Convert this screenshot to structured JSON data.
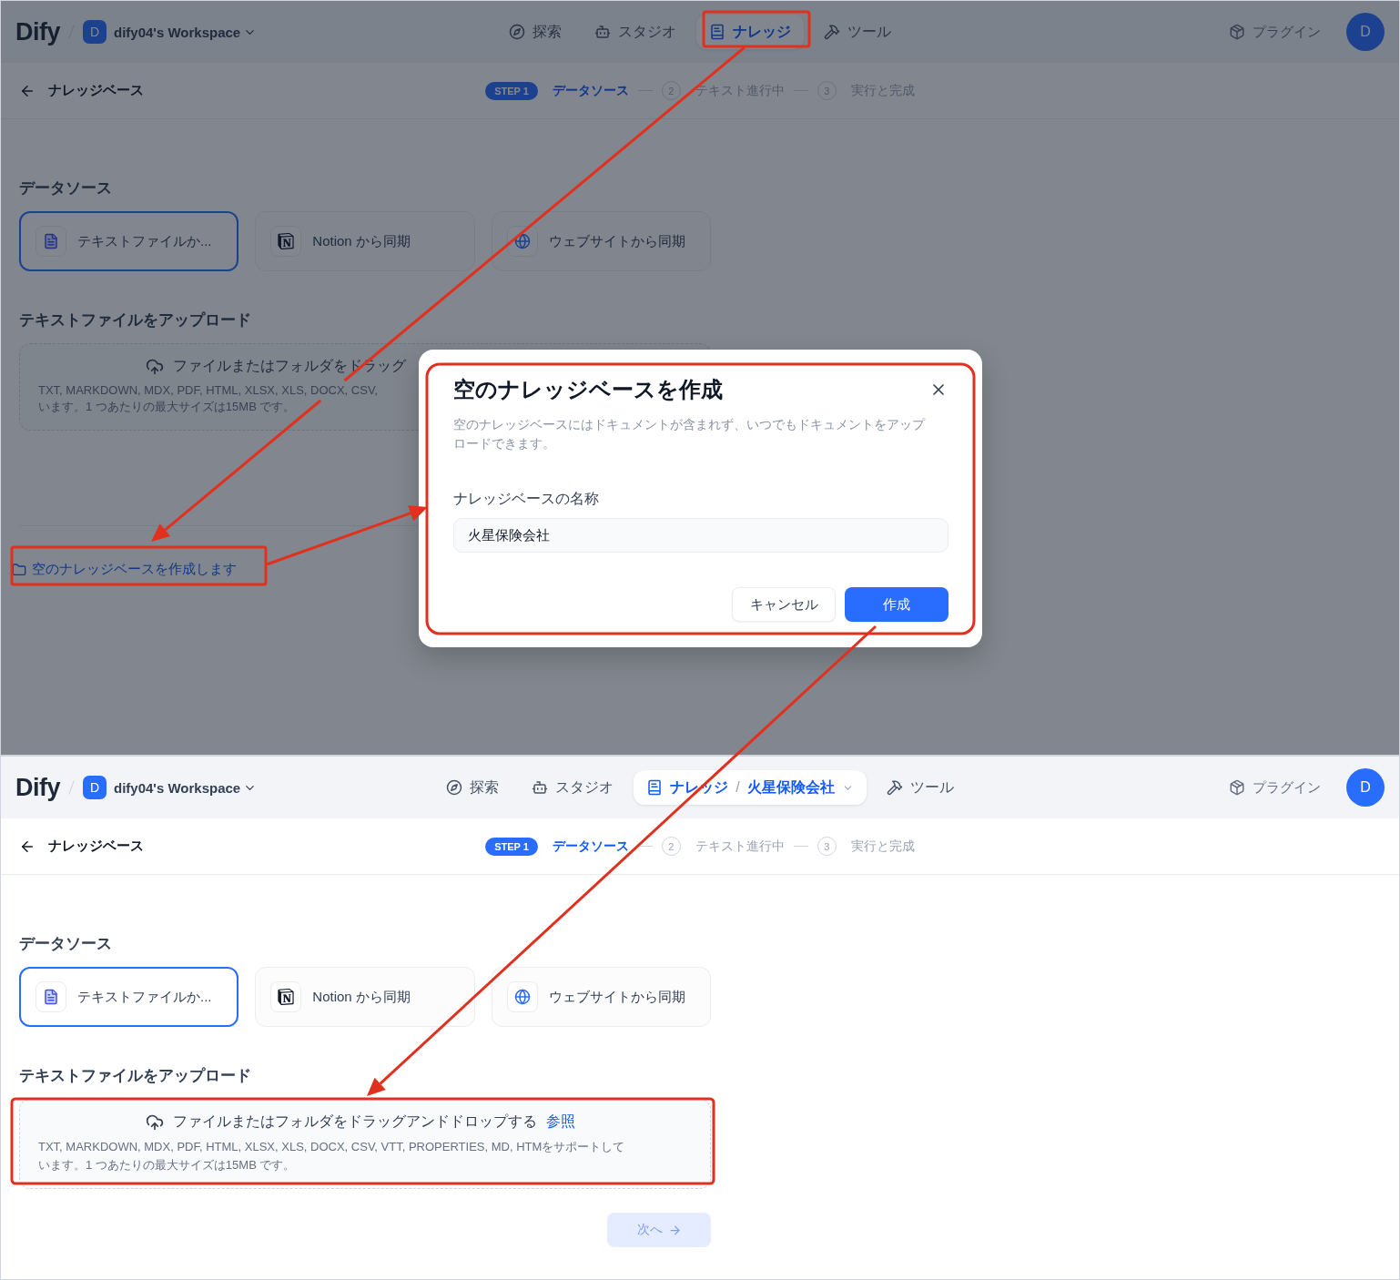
{
  "top_screen": {
    "dimmed": true,
    "header": {
      "logo": "Dify",
      "workspace_badge": "D",
      "workspace": "dify04's Workspace",
      "nav": [
        {
          "label": "探索",
          "selected": false
        },
        {
          "label": "スタジオ",
          "selected": false
        },
        {
          "label": "ナレッジ",
          "selected": true
        },
        {
          "label": "ツール",
          "selected": false
        }
      ],
      "plugins": "プラグイン",
      "avatar": "D"
    },
    "step_bar": {
      "back_label": "ナレッジベース",
      "steps": [
        {
          "number": "STEP 1",
          "label": "データソース",
          "selected": true
        },
        {
          "number": "2",
          "label": "テキスト進行中",
          "selected": false
        },
        {
          "number": "3",
          "label": "実行と完成",
          "selected": false
        }
      ]
    },
    "data_source": {
      "heading": "データソース",
      "options": [
        {
          "label": "テキストファイルか...",
          "selected": true
        },
        {
          "label": "Notion から同期",
          "selected": false
        },
        {
          "label": "ウェブサイトから同期",
          "selected": false
        }
      ]
    },
    "upload": {
      "heading": "テキストファイルをアップロード",
      "prompt": "ファイルまたはフォルダをドラッグ",
      "hint_lines": [
        "TXT, MARKDOWN, MDX, PDF, HTML, XLSX, XLS, DOCX, CSV,",
        "います。1 つあたりの最大サイズは15MB です。"
      ]
    },
    "empty_kb_link": "空のナレッジベースを作成します",
    "dialog": {
      "title": "空のナレッジベースを作成",
      "description": "空のナレッジベースにはドキュメントが含まれず、いつでもドキュメントをアップロードできます。",
      "name_label": "ナレッジベースの名称",
      "name_value": "火星保険会社",
      "cancel": "キャンセル",
      "confirm": "作成"
    }
  },
  "bottom_screen": {
    "dimmed": false,
    "header": {
      "logo": "Dify",
      "workspace_badge": "D",
      "workspace": "dify04's Workspace",
      "nav": [
        {
          "label": "探索",
          "selected": false
        },
        {
          "label": "スタジオ",
          "selected": false
        },
        {
          "label": "ナレッジ",
          "selected": true,
          "crumb_separator": "/",
          "crumb": "火星保険会社"
        },
        {
          "label": "ツール",
          "selected": false
        }
      ],
      "plugins": "プラグイン",
      "avatar": "D"
    },
    "step_bar": {
      "back_label": "ナレッジベース",
      "steps": [
        {
          "number": "STEP 1",
          "label": "データソース",
          "selected": true
        },
        {
          "number": "2",
          "label": "テキスト進行中",
          "selected": false
        },
        {
          "number": "3",
          "label": "実行と完成",
          "selected": false
        }
      ]
    },
    "data_source": {
      "heading": "データソース",
      "options": [
        {
          "label": "テキストファイルか...",
          "selected": true
        },
        {
          "label": "Notion から同期",
          "selected": false
        },
        {
          "label": "ウェブサイトから同期",
          "selected": false
        }
      ]
    },
    "upload": {
      "heading": "テキストファイルをアップロード",
      "prompt": "ファイルまたはフォルダをドラッグアンドドロップする",
      "browse": "参照",
      "hint_lines": [
        "TXT, MARKDOWN, MDX, PDF, HTML, XLSX, XLS, DOCX, CSV, VTT, PROPERTIES, MD, HTMをサポートして",
        "います。1 つあたりの最大サイズは15MB です。"
      ]
    },
    "next_button": {
      "label": "次へ",
      "disabled": true
    }
  }
}
